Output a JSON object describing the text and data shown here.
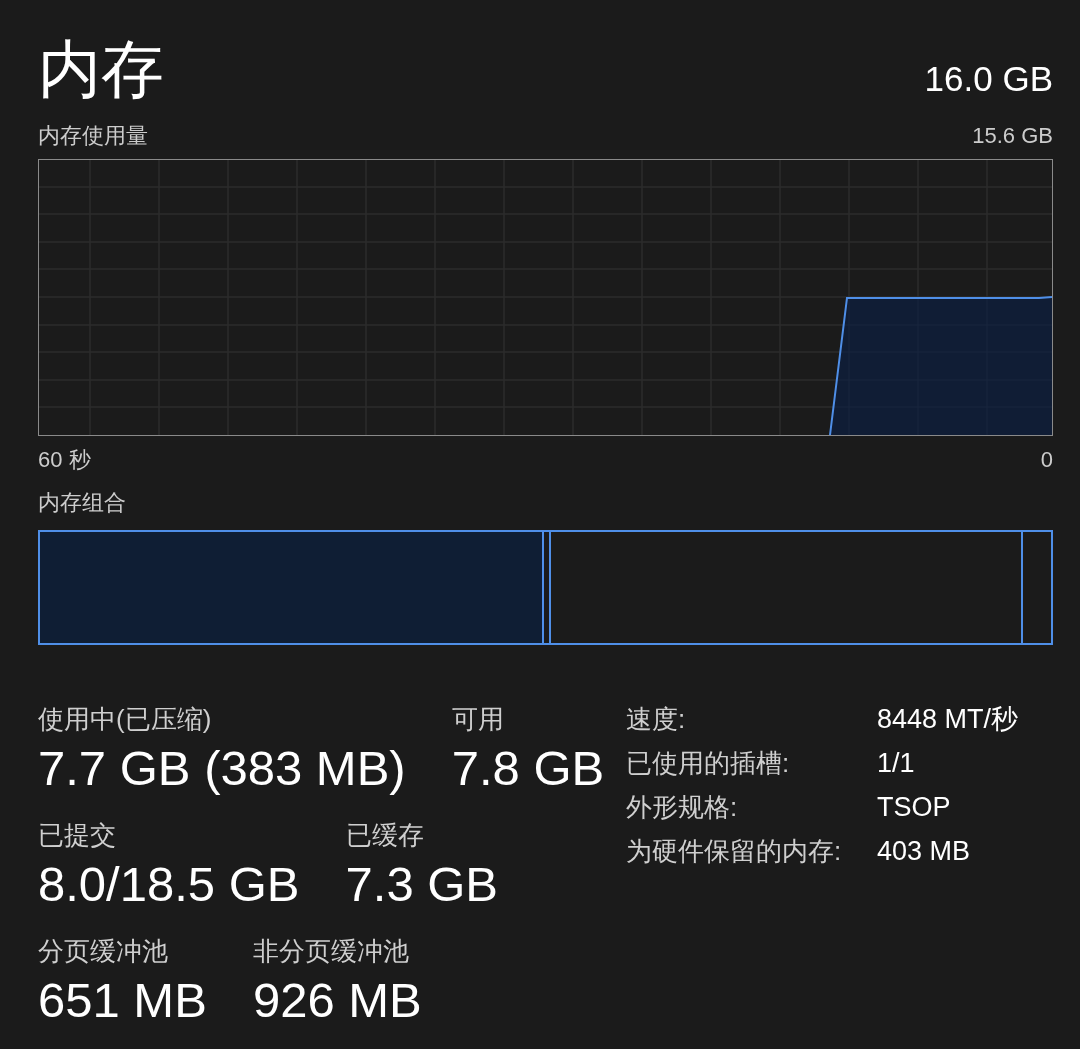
{
  "header": {
    "title": "内存",
    "total": "16.0 GB"
  },
  "usage_graph": {
    "label": "内存使用量",
    "max_value": "15.6 GB",
    "axis_start": "60 秒",
    "axis_end": "0"
  },
  "composition": {
    "label": "内存组合",
    "level": 0.499,
    "dividers": [
      {
        "level": 0.504
      },
      {
        "level": 0.971
      }
    ]
  },
  "stat_rows": [
    {
      "items": [
        {
          "label": "使用中(已压缩)",
          "value": "7.7 GB (383 MB)"
        },
        {
          "label": "可用",
          "value": "7.8 GB"
        }
      ]
    },
    {
      "items": [
        {
          "label": "已提交",
          "value": "8.0/18.5 GB"
        },
        {
          "label": "已缓存",
          "value": "7.3 GB"
        }
      ]
    },
    {
      "items": [
        {
          "label": "分页缓冲池",
          "value": "651 MB"
        },
        {
          "label": "非分页缓冲池",
          "value": "926 MB"
        }
      ]
    }
  ],
  "details": [
    {
      "label": "速度:",
      "value": "8448 MT/秒"
    },
    {
      "label": "已使用的插槽:",
      "value": "1/1"
    },
    {
      "label": "外形规格:",
      "value": "TSOP"
    },
    {
      "label": "为硬件保留的内存:",
      "value": "403 MB"
    }
  ]
}
